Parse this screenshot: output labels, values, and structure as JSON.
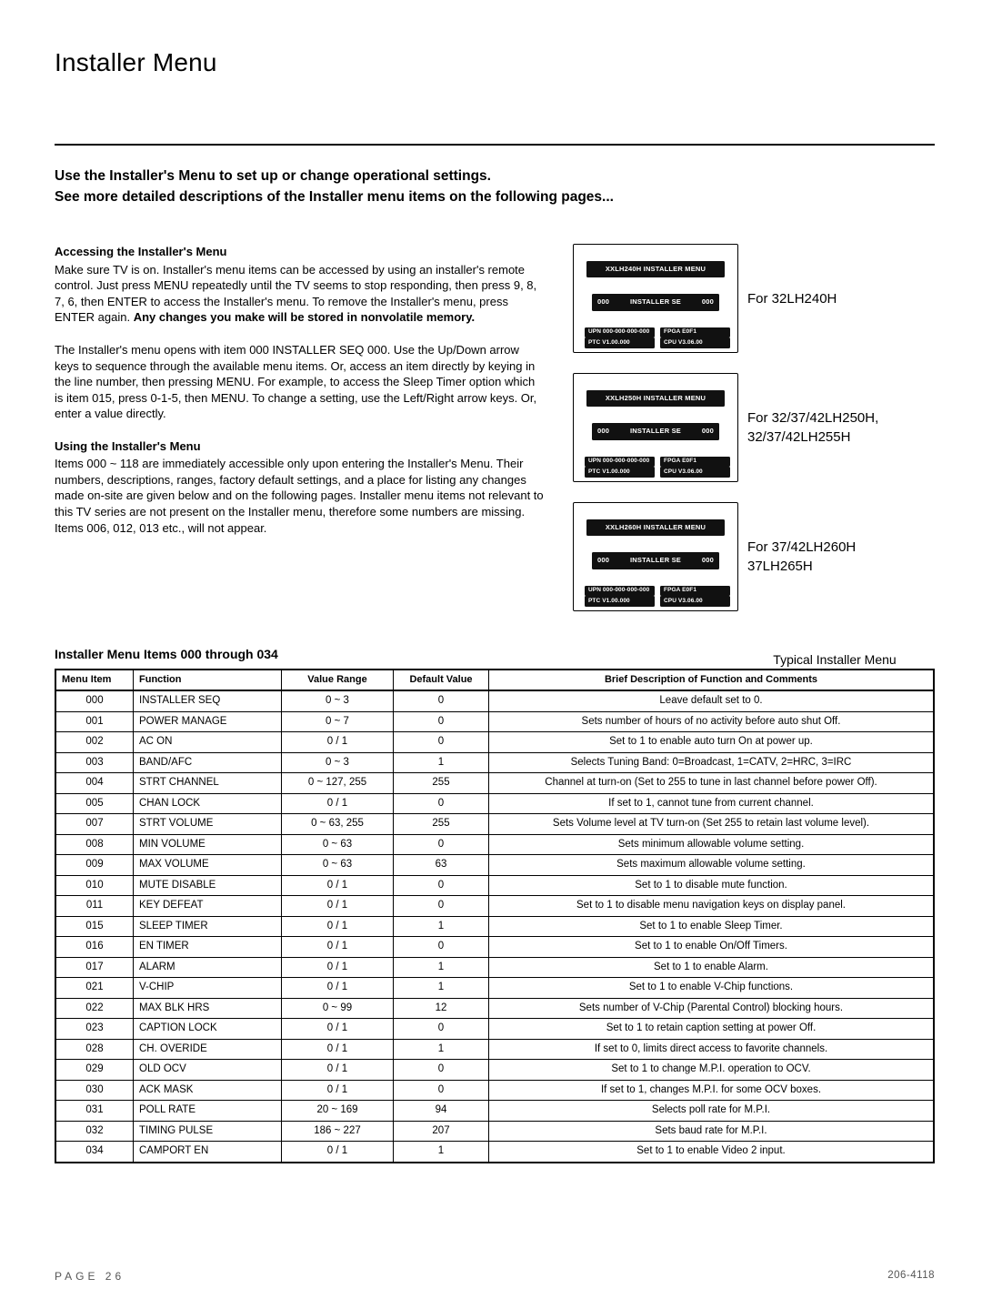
{
  "page_title": "Installer Menu",
  "intro_line1": "Use the Installer's Menu to set up or change operational settings.",
  "intro_line2": "See more detailed descriptions of the Installer menu items on the following pages...",
  "access": {
    "heading": "Accessing the Installer's Menu",
    "p1_a": "Make sure TV is on. Installer's menu items can be accessed by using an installer's remote control. Just press MENU repeatedly until the TV seems to stop responding, then press 9, 8, 7, 6, then ENTER to access the Installer's menu. To remove the Installer's menu, press ENTER again. ",
    "p1_b_bold": "Any changes you make will be stored in nonvolatile memory.",
    "p2": "The Installer's menu opens with item 000 INSTALLER SEQ 000. Use the Up/Down arrow keys to sequence through the available menu items. Or, access an item directly by keying in the line number, then pressing MENU. For example, to access the Sleep Timer option which is item 015, press 0-1-5, then MENU. To change a setting, use the Left/Right arrow keys. Or, enter a value directly."
  },
  "using": {
    "heading": "Using the Installer's Menu",
    "p1": "Items 000 ~ 118 are immediately accessible only upon entering the Installer's Menu. Their numbers, descriptions, ranges, factory default settings, and a place for listing any changes made on-site are given below and on the following pages. Installer menu items not relevant to this TV series are not present on the Installer menu, therefore some numbers are missing.  Items 006, 012, 013 etc., will not appear."
  },
  "menus": [
    {
      "hdr": "XXLH240H INSTALLER  MENU",
      "line_l": "000",
      "line_m": "INSTALLER SE",
      "line_r": "000",
      "f1": "UPN   000-000-000-000",
      "f2": "FPGA E0F1",
      "f3": "PTC V1.00.000",
      "f4": "CPU V3.06.00",
      "label": "For 32LH240H"
    },
    {
      "hdr": "XXLH250H INSTALLER  MENU",
      "line_l": "000",
      "line_m": "INSTALLER SE",
      "line_r": "000",
      "f1": "UPN   000-000-000-000",
      "f2": "FPGA E0F1",
      "f3": "PTC V1.00.000",
      "f4": "CPU V3.06.00",
      "label": "For 32/37/42LH250H,\n32/37/42LH255H"
    },
    {
      "hdr": "XXLH260H INSTALLER  MENU",
      "line_l": "000",
      "line_m": "INSTALLER SE",
      "line_r": "000",
      "f1": "UPN   000-000-000-000",
      "f2": "FPGA E0F1",
      "f3": "PTC V1.00.000",
      "f4": "CPU V3.06.00",
      "label": "For 37/42LH260H\n37LH265H"
    }
  ],
  "tim_caption": "Typical Installer Menu",
  "table_title": "Installer Menu Items 000 through 034",
  "table_headers": {
    "c1": "Menu Item",
    "c2": "Function",
    "c3": "Value Range",
    "c4": "Default Value",
    "c5": "Brief Description of Function and Comments"
  },
  "rows": [
    {
      "i": "000",
      "f": "INSTALLER SEQ",
      "r": "0 ~ 3",
      "d": "0",
      "c": "Leave default set to 0."
    },
    {
      "i": "001",
      "f": "POWER MANAGE",
      "r": "0 ~ 7",
      "d": "0",
      "c": "Sets number of hours of no activity before auto shut Off."
    },
    {
      "i": "002",
      "f": "AC ON",
      "r": "0 / 1",
      "d": "0",
      "c": "Set to 1 to enable auto turn On at power up."
    },
    {
      "i": "003",
      "f": "BAND/AFC",
      "r": "0 ~ 3",
      "d": "1",
      "c": "Selects Tuning Band: 0=Broadcast, 1=CATV, 2=HRC, 3=IRC"
    },
    {
      "i": "004",
      "f": "STRT CHANNEL",
      "r": "0 ~ 127, 255",
      "d": "255",
      "c": "Channel at turn-on (Set to 255 to tune in last channel before power Off)."
    },
    {
      "i": "005",
      "f": "CHAN LOCK",
      "r": "0 / 1",
      "d": "0",
      "c": "If set to 1, cannot tune from current channel."
    },
    {
      "i": "007",
      "f": "STRT VOLUME",
      "r": "0 ~ 63, 255",
      "d": "255",
      "c": "Sets Volume level at TV turn-on (Set 255 to retain last volume level)."
    },
    {
      "i": "008",
      "f": "MIN VOLUME",
      "r": "0 ~ 63",
      "d": "0",
      "c": "Sets minimum allowable volume setting."
    },
    {
      "i": "009",
      "f": "MAX VOLUME",
      "r": "0 ~ 63",
      "d": "63",
      "c": "Sets maximum allowable volume setting."
    },
    {
      "i": "010",
      "f": "MUTE DISABLE",
      "r": "0 / 1",
      "d": "0",
      "c": "Set to 1 to disable mute function."
    },
    {
      "i": "011",
      "f": "KEY DEFEAT",
      "r": "0 / 1",
      "d": "0",
      "c": "Set to 1 to disable menu navigation keys on display panel."
    },
    {
      "i": "015",
      "f": "SLEEP TIMER",
      "r": "0 / 1",
      "d": "1",
      "c": "Set to 1 to enable Sleep Timer."
    },
    {
      "i": "016",
      "f": "EN TIMER",
      "r": "0 / 1",
      "d": "0",
      "c": "Set to 1 to enable On/Off Timers."
    },
    {
      "i": "017",
      "f": "ALARM",
      "r": "0 / 1",
      "d": "1",
      "c": "Set to 1 to enable Alarm."
    },
    {
      "i": "021",
      "f": "V-CHIP",
      "r": "0 / 1",
      "d": "1",
      "c": "Set to 1 to enable V-Chip functions."
    },
    {
      "i": "022",
      "f": "MAX BLK HRS",
      "r": "0 ~ 99",
      "d": "12",
      "c": "Sets number of V-Chip (Parental Control) blocking hours."
    },
    {
      "i": "023",
      "f": "CAPTION LOCK",
      "r": "0 / 1",
      "d": "0",
      "c": "Set to 1 to retain caption setting at power Off."
    },
    {
      "i": "028",
      "f": "CH. OVERIDE",
      "r": "0 / 1",
      "d": "1",
      "c": "If set to 0, limits direct access to favorite channels."
    },
    {
      "i": "029",
      "f": "OLD OCV",
      "r": "0 / 1",
      "d": "0",
      "c": "Set to 1 to change M.P.I. operation to OCV."
    },
    {
      "i": "030",
      "f": "ACK MASK",
      "r": "0 / 1",
      "d": "0",
      "c": "If set to 1, changes M.P.I. for some OCV boxes."
    },
    {
      "i": "031",
      "f": "POLL RATE",
      "r": "20 ~ 169",
      "d": "94",
      "c": "Selects poll rate for M.P.I."
    },
    {
      "i": "032",
      "f": "TIMING PULSE",
      "r": "186 ~ 227",
      "d": "207",
      "c": "Sets baud rate for M.P.I."
    },
    {
      "i": "034",
      "f": "CAMPORT EN",
      "r": "0 / 1",
      "d": "1",
      "c": "Set to 1 to enable Video 2 input."
    }
  ],
  "footer": {
    "page": "PAGE 26",
    "doc": "206-4118"
  }
}
